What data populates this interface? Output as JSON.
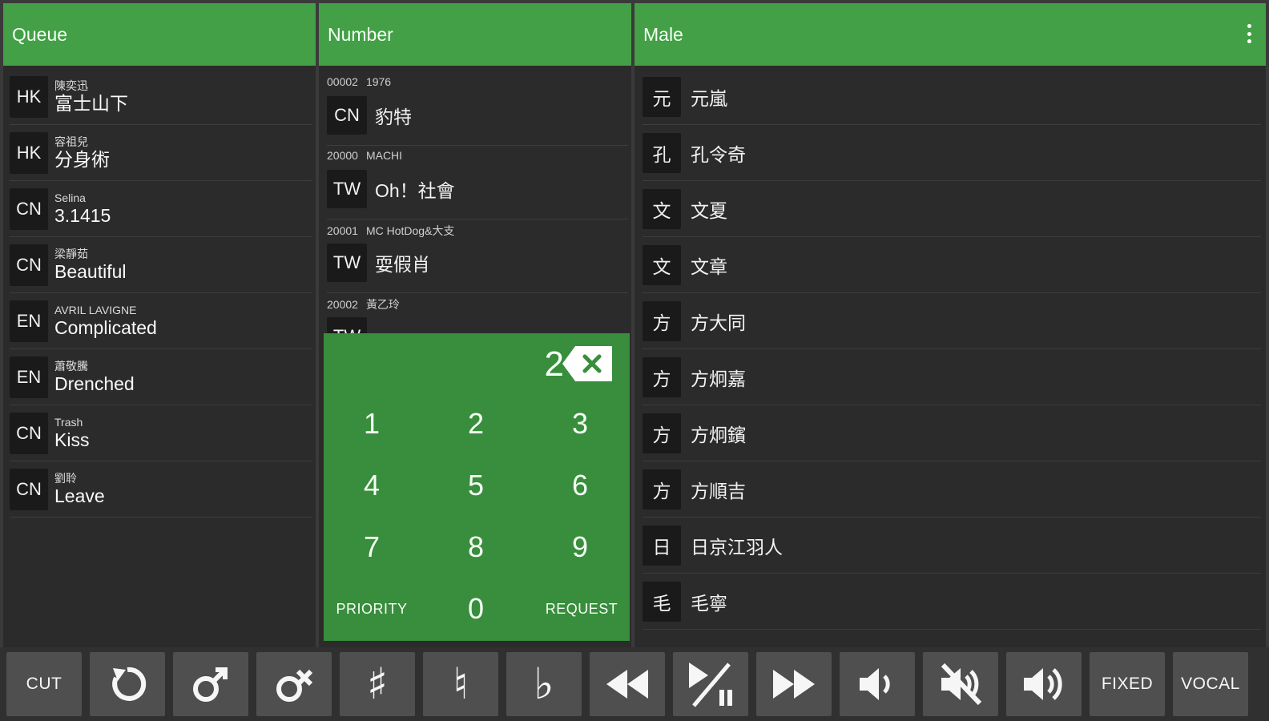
{
  "queue": {
    "title": "Queue",
    "items": [
      {
        "lang": "HK",
        "artist": "陳奕迅",
        "title": "富士山下"
      },
      {
        "lang": "HK",
        "artist": "容祖兒",
        "title": "分身術"
      },
      {
        "lang": "CN",
        "artist": "Selina",
        "title": "3.1415"
      },
      {
        "lang": "CN",
        "artist": "梁靜茹",
        "title": "Beautiful"
      },
      {
        "lang": "EN",
        "artist": "AVRIL LAVIGNE",
        "title": "Complicated"
      },
      {
        "lang": "EN",
        "artist": "蕭敬騰",
        "title": "Drenched"
      },
      {
        "lang": "CN",
        "artist": "Trash",
        "title": "Kiss"
      },
      {
        "lang": "CN",
        "artist": "劉聆",
        "title": "Leave"
      }
    ]
  },
  "number": {
    "title": "Number",
    "items": [
      {
        "code": "00002",
        "artist": "1976",
        "lang": "CN",
        "title": "豹特"
      },
      {
        "code": "20000",
        "artist": "MACHI",
        "lang": "TW",
        "title": "Oh！社會"
      },
      {
        "code": "20001",
        "artist": "MC HotDog&大支",
        "lang": "TW",
        "title": "耍假肖"
      },
      {
        "code": "20002",
        "artist": "黃乙玲",
        "lang": "TW",
        "title": ""
      }
    ]
  },
  "numpad": {
    "display": "2",
    "keys": [
      "1",
      "2",
      "3",
      "4",
      "5",
      "6",
      "7",
      "8",
      "9"
    ],
    "priority_label": "PRIORITY",
    "zero_label": "0",
    "request_label": "REQUEST"
  },
  "singers": {
    "title": "Male",
    "items": [
      {
        "initial": "元",
        "name": "元嵐"
      },
      {
        "initial": "孔",
        "name": "孔令奇"
      },
      {
        "initial": "文",
        "name": "文夏"
      },
      {
        "initial": "文",
        "name": "文章"
      },
      {
        "initial": "方",
        "name": "方大同"
      },
      {
        "initial": "方",
        "name": "方炯嘉"
      },
      {
        "initial": "方",
        "name": "方炯鑌"
      },
      {
        "initial": "方",
        "name": "方順吉"
      },
      {
        "initial": "日",
        "name": "日京江羽人"
      },
      {
        "initial": "毛",
        "name": "毛寧"
      }
    ]
  },
  "toolbar": {
    "cut_label": "CUT",
    "sharp_glyph": "♯",
    "natural_glyph": "♮",
    "flat_glyph": "♭",
    "fixed_label": "FIXED",
    "vocal_label": "VOCAL"
  },
  "colors": {
    "header_green": "#43a047",
    "numpad_green": "#388e3c",
    "panel_bg": "#2b2b2b",
    "button_bg": "#4f4f4f"
  }
}
